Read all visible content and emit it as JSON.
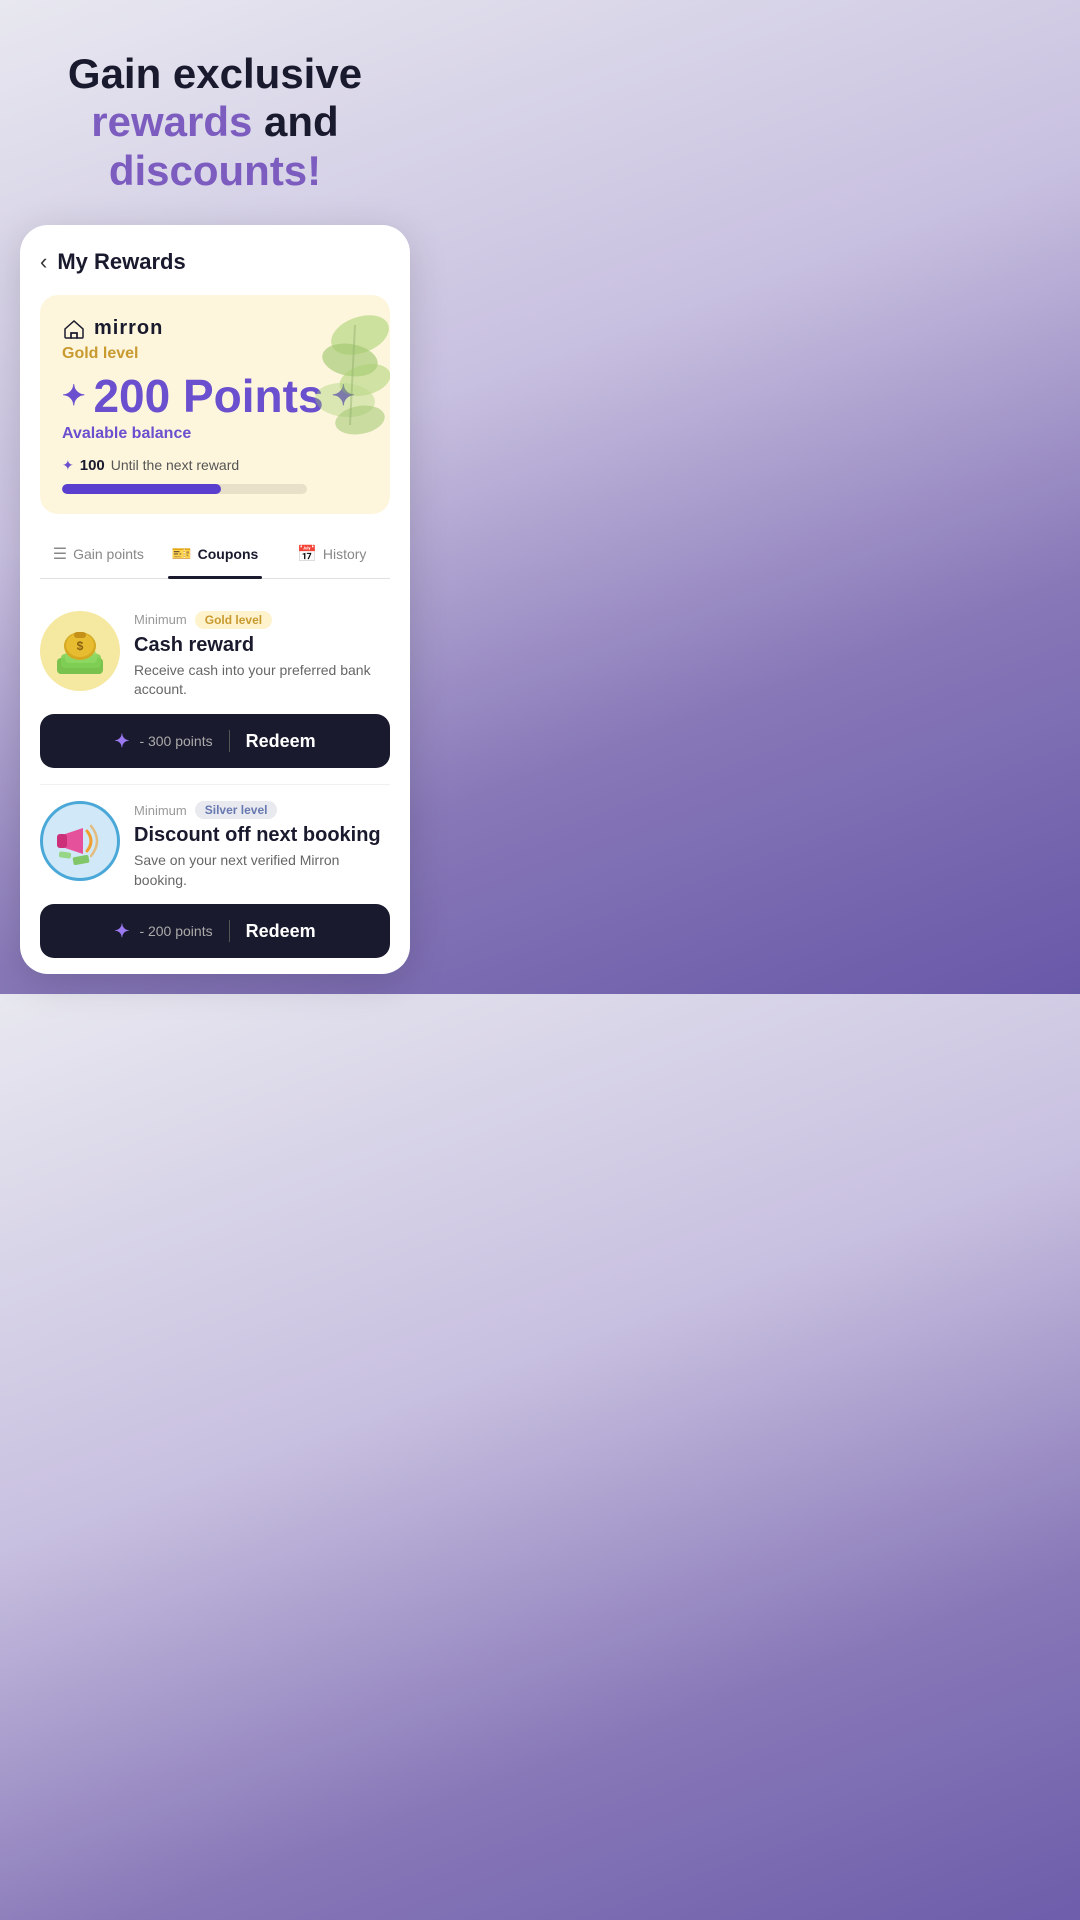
{
  "hero": {
    "line1": "Gain exclusive",
    "line2": "rewards and",
    "line3": "discounts!"
  },
  "header": {
    "back_label": "‹",
    "title": "My Rewards"
  },
  "points_card": {
    "brand_name": "mirron",
    "level": "Gold level",
    "points": "200 Points",
    "available_label": "Avalable balance",
    "next_reward_count": "100",
    "next_reward_label": "Until the next reward",
    "progress_percent": 65
  },
  "tabs": [
    {
      "id": "gain",
      "label": "Gain points",
      "active": false
    },
    {
      "id": "coupons",
      "label": "Coupons",
      "active": true
    },
    {
      "id": "history",
      "label": "History",
      "active": false
    }
  ],
  "coupons": [
    {
      "id": "cash",
      "minimum_label": "Minimum",
      "level": "Gold level",
      "level_type": "gold",
      "title": "Cash reward",
      "description": "Receive cash into your preferred bank account.",
      "redeem_points": "- 300 points",
      "redeem_label": "Redeem"
    },
    {
      "id": "discount",
      "minimum_label": "Minimum",
      "level": "Silver level",
      "level_type": "silver",
      "title": "Discount off next booking",
      "description": "Save on your next verified Mirron booking.",
      "redeem_points": "- 200 points",
      "redeem_label": "Redeem"
    }
  ]
}
